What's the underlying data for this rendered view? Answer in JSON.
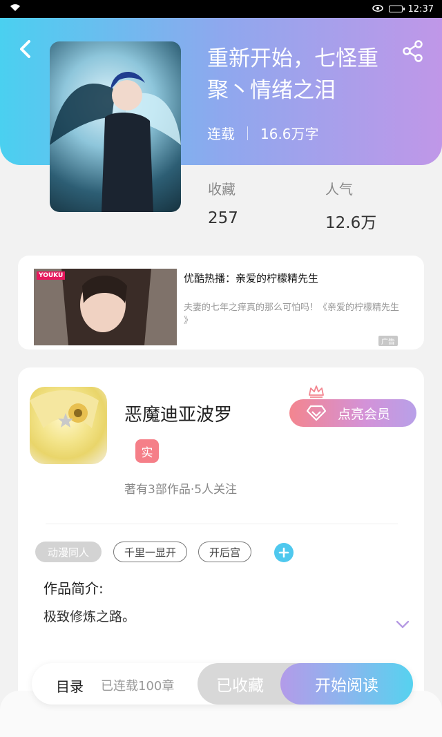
{
  "status_bar": {
    "time": "12:37"
  },
  "book": {
    "title": "重新开始，七怪重聚丶情绪之泪",
    "status": "连载",
    "word_count": "16.6万字",
    "stats": [
      {
        "label": "收藏",
        "value": "257"
      },
      {
        "label": "人气",
        "value": "12.6万"
      }
    ]
  },
  "ad": {
    "logo": "YOUKU",
    "title": "优酷热播：亲爱的柠檬精先生",
    "description": "夫妻的七年之痒真的那么可怕吗！《亲爱的柠檬精先生 》",
    "badge": "广告"
  },
  "author": {
    "name": "恶魔迪亚波罗",
    "verified_badge": "实",
    "stats": "著有3部作品·5人关注",
    "vip_button": "点亮会员"
  },
  "tags": [
    "动漫同人",
    "千里一显开",
    "开后宫"
  ],
  "intro": {
    "heading": "作品简介:",
    "text": "极致修炼之路。"
  },
  "bottom_bar": {
    "toc_label": "目录",
    "toc_status": "已连载100章",
    "collected_label": "已收藏",
    "read_label": "开始阅读"
  }
}
